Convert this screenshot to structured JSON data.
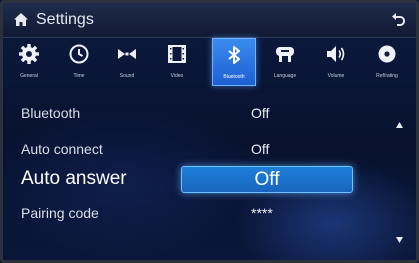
{
  "header": {
    "title": "Settings"
  },
  "tabs": [
    {
      "label": "General",
      "icon": "gear-icon"
    },
    {
      "label": "Time",
      "icon": "clock-icon"
    },
    {
      "label": "Sound",
      "icon": "sound-icon"
    },
    {
      "label": "Video",
      "icon": "film-icon"
    },
    {
      "label": "Bluetooth",
      "icon": "bluetooth-icon",
      "active": true
    },
    {
      "label": "Language",
      "icon": "language-icon"
    },
    {
      "label": "Volume",
      "icon": "volume-icon"
    },
    {
      "label": "Ref/rating",
      "icon": "disc-icon"
    }
  ],
  "rows": [
    {
      "label": "Bluetooth",
      "value": "Off"
    },
    {
      "label": "Auto connect",
      "value": "Off"
    },
    {
      "label": "Auto answer",
      "value": "Off",
      "selected": true
    },
    {
      "label": "Pairing code",
      "value": "****"
    }
  ],
  "colors": {
    "accent": "#1e6fd0",
    "background": "#0b1736"
  }
}
